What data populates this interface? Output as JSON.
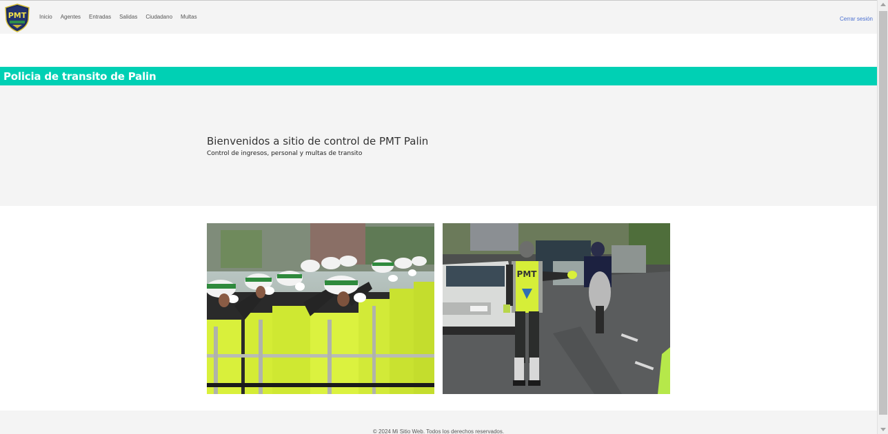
{
  "navbar": {
    "logo_text": "PMT",
    "links": [
      "Inicio",
      "Agentes",
      "Entradas",
      "Salidas",
      "Ciudadano",
      "Multas"
    ],
    "logout": "Cerrar sesión"
  },
  "banner": {
    "title": "Policia de transito de Palin"
  },
  "hero": {
    "title": "Bienvenidos a sitio de control de PMT Palin",
    "subtitle": "Control de ingresos, personal y multas de transito"
  },
  "images": [
    {
      "name": "officers-saluting-photo"
    },
    {
      "name": "officer-directing-traffic-photo"
    }
  ],
  "footer": {
    "text": "© 2024 Mi Sitio Web. Todos los derechos reservados."
  },
  "colors": {
    "banner": "#00d0b4",
    "link_logout": "#4a6fd0",
    "nav_bg": "#f4f4f4"
  }
}
